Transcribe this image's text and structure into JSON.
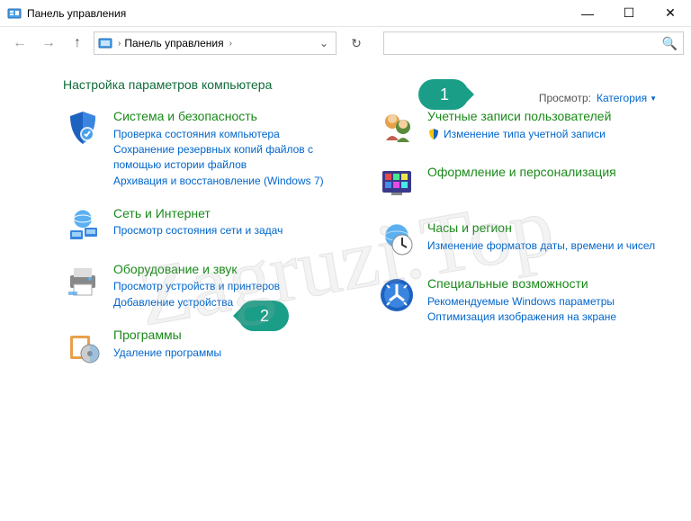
{
  "window": {
    "title": "Панель управления"
  },
  "nav": {
    "breadcrumb": "Панель управления"
  },
  "page": {
    "heading": "Настройка параметров компьютера",
    "view_label": "Просмотр:",
    "view_value": "Категория"
  },
  "left": [
    {
      "title": "Система и безопасность",
      "links": [
        "Проверка состояния компьютера",
        "Сохранение резервных копий файлов с помощью истории файлов",
        "Архивация и восстановление (Windows 7)"
      ]
    },
    {
      "title": "Сеть и Интернет",
      "links": [
        "Просмотр состояния сети и задач"
      ]
    },
    {
      "title": "Оборудование и звук",
      "links": [
        "Просмотр устройств и принтеров",
        "Добавление устройства"
      ]
    },
    {
      "title": "Программы",
      "links": [
        "Удаление программы"
      ]
    }
  ],
  "right": [
    {
      "title": "Учетные записи пользователей",
      "links": [
        "Изменение типа учетной записи"
      ],
      "shield": true
    },
    {
      "title": "Оформление и персонализация",
      "links": []
    },
    {
      "title": "Часы и регион",
      "links": [
        "Изменение форматов даты, времени и чисел"
      ]
    },
    {
      "title": "Специальные возможности",
      "links": [
        "Рекомендуемые Windows параметры",
        "Оптимизация изображения на экране"
      ]
    }
  ],
  "markers": {
    "m1": "1",
    "m2": "2"
  },
  "watermark": "Zagruzi.Top"
}
